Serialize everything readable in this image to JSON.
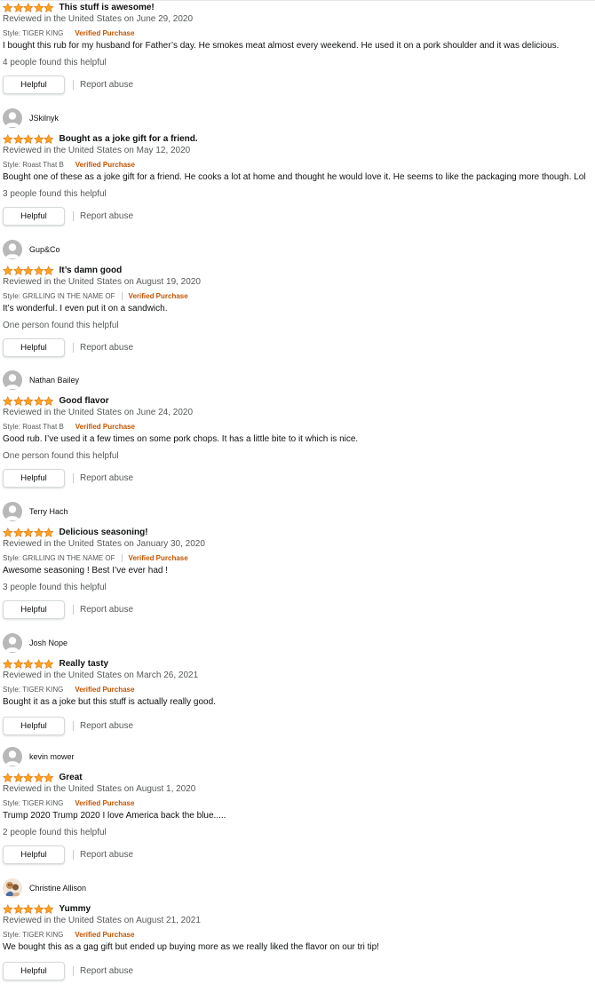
{
  "colors": {
    "star": "#ffa41c",
    "star_outline": "#de7921",
    "verified": "#c45500",
    "secondary_text": "#565959"
  },
  "reviews": [
    {
      "reviewer": "",
      "rating": 5,
      "title": "This stuff is awesome!",
      "date": "Reviewed in the United States on June 29, 2020",
      "style": "Style: TIGER KING",
      "verified": "Verified Purchase",
      "body": "I bought this rub for my husband for Father’s day. He smokes meat almost every weekend. He used it on a pork shoulder and it was delicious.",
      "helpful_count": "4 people found this helpful",
      "helpful_button": "Helpful",
      "report": "Report abuse"
    },
    {
      "reviewer": "JSkilnyk",
      "rating": 5,
      "title": "Bought as a joke gift for a friend.",
      "date": "Reviewed in the United States on May 12, 2020",
      "style": "Style: Roast That B",
      "verified": "Verified Purchase",
      "body": "Bought one of these as a joke gift for a friend. He cooks a lot at home and thought he would love it. He seems to like the packaging more though. Lol",
      "helpful_count": "3 people found this helpful",
      "helpful_button": "Helpful",
      "report": "Report abuse"
    },
    {
      "reviewer": "Gup&Co",
      "rating": 5,
      "title": "It’s damn good",
      "date": "Reviewed in the United States on August 19, 2020",
      "style": "Style: GRILLING IN THE NAME OF",
      "verified": "Verified Purchase",
      "body": "It’s wonderful. I even put it on a sandwich.",
      "helpful_count": "One person found this helpful",
      "helpful_button": "Helpful",
      "report": "Report abuse"
    },
    {
      "reviewer": "Nathan Bailey",
      "rating": 5,
      "title": "Good flavor",
      "date": "Reviewed in the United States on June 24, 2020",
      "style": "Style: Roast That B",
      "verified": "Verified Purchase",
      "body": "Good rub. I’ve used it a few times on some pork chops. It has a little bite to it which is nice.",
      "helpful_count": "One person found this helpful",
      "helpful_button": "Helpful",
      "report": "Report abuse"
    },
    {
      "reviewer": "Terry Hach",
      "rating": 5,
      "title": "Delicious seasoning!",
      "date": "Reviewed in the United States on January 30, 2020",
      "style": "Style: GRILLING IN THE NAME OF",
      "verified": "Verified Purchase",
      "body": "Awesome seasoning ! Best I’ve ever had !",
      "helpful_count": "3 people found this helpful",
      "helpful_button": "Helpful",
      "report": "Report abuse"
    },
    {
      "reviewer": "Josh Nope",
      "rating": 5,
      "title": "Really tasty",
      "date": "Reviewed in the United States on March 26, 2021",
      "style": "Style: TIGER KING",
      "verified": "Verified Purchase",
      "body": "Bought it as a joke but this stuff is actually really good.",
      "helpful_count": "",
      "helpful_button": "Helpful",
      "report": "Report abuse"
    },
    {
      "reviewer": "kevin mower",
      "rating": 5,
      "title": "Great",
      "date": "Reviewed in the United States on August 1, 2020",
      "style": "Style: TIGER KING",
      "verified": "Verified Purchase",
      "body": "Trump 2020 Trump 2020 I love America back the blue.....",
      "helpful_count": "2 people found this helpful",
      "helpful_button": "Helpful",
      "report": "Report abuse"
    },
    {
      "reviewer": "Christine Allison",
      "avatar_icon": "custom-photo-avatar",
      "rating": 5,
      "title": "Yummy",
      "date": "Reviewed in the United States on August 21, 2021",
      "style": "Style: TIGER KING",
      "verified": "Verified Purchase",
      "body": "We bought this as a gag gift but ended up buying more as we really liked the flavor on our tri tip!",
      "helpful_count": "",
      "helpful_button": "Helpful",
      "report": "Report abuse"
    }
  ]
}
